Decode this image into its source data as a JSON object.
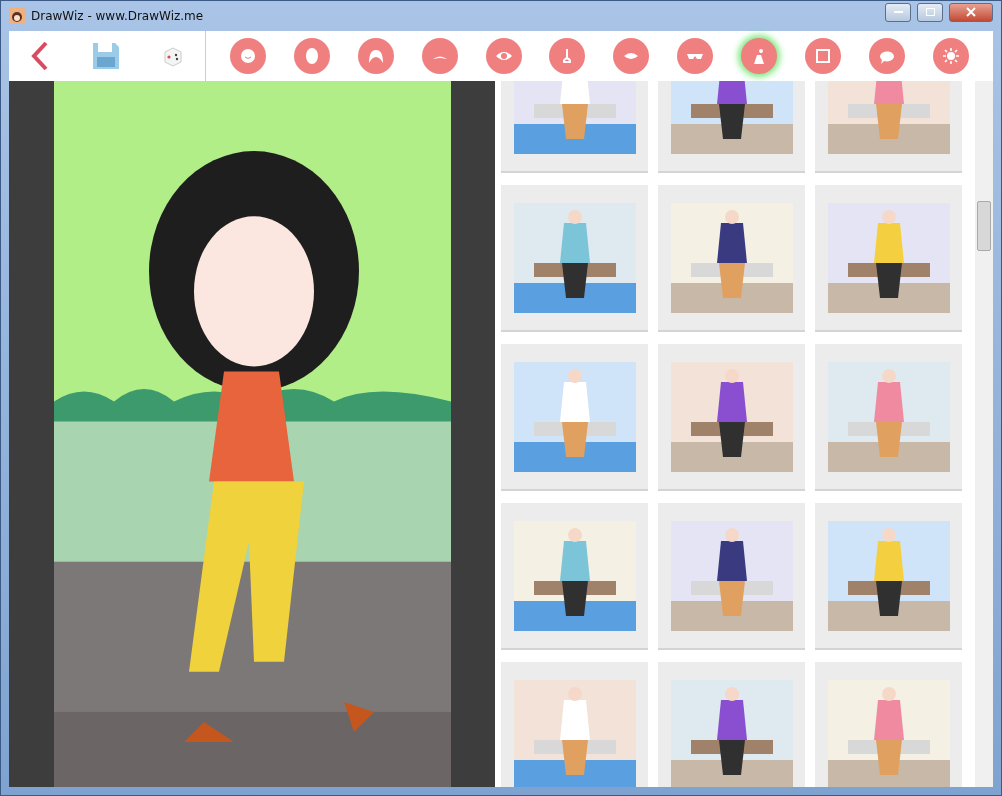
{
  "window": {
    "title": "DrawWiz - www.DrawWiz.me"
  },
  "toolbar": {
    "categories": [
      {
        "selected": false
      },
      {
        "selected": false
      },
      {
        "selected": false
      },
      {
        "selected": false
      },
      {
        "selected": false
      },
      {
        "selected": false
      },
      {
        "selected": false
      },
      {
        "selected": false
      },
      {
        "selected": true
      },
      {
        "selected": false
      },
      {
        "selected": false
      },
      {
        "selected": false
      }
    ]
  }
}
